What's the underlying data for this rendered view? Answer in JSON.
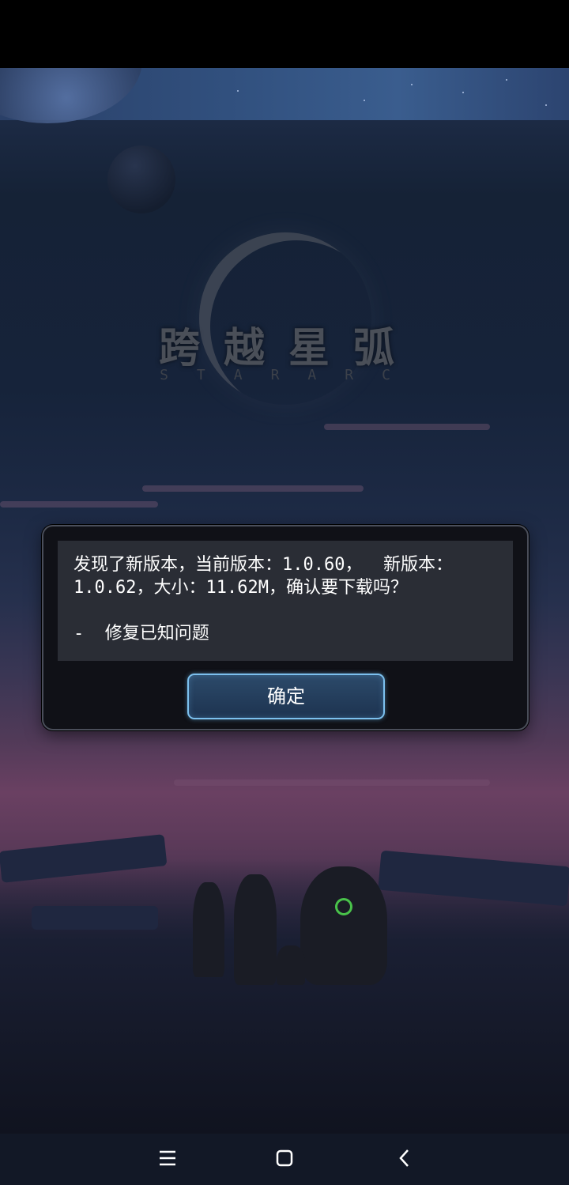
{
  "game": {
    "logo_title": "跨越星弧",
    "logo_subtitle": "STARARC"
  },
  "dialog": {
    "message": "发现了新版本，当前版本：1.0.60，  新版本：\n1.0.62，大小：11.62M，确认要下载吗？\n\n-  修复已知问题",
    "confirm_label": "确定"
  },
  "nav_bar": {
    "icons": [
      "menu-icon",
      "home-icon",
      "back-icon"
    ]
  },
  "colors": {
    "button_border": "#7cc0ee",
    "dialog_bg": "#101117",
    "message_bg": "#2a2d35"
  }
}
